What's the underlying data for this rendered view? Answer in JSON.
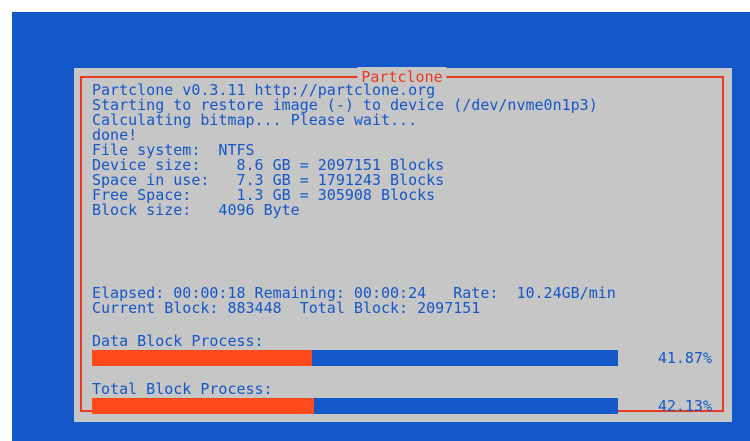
{
  "dialog": {
    "title": "Partclone"
  },
  "info": {
    "lines": [
      "Partclone v0.3.11 http://partclone.org",
      "Starting to restore image (-) to device (/dev/nvme0n1p3)",
      "Calculating bitmap... Please wait...",
      "done!",
      "File system:  NTFS",
      "Device size:    8.6 GB = 2097151 Blocks",
      "Space in use:   7.3 GB = 1791243 Blocks",
      "Free Space:     1.3 GB = 305908 Blocks",
      "Block size:   4096 Byte"
    ]
  },
  "stats": {
    "line1": "Elapsed: 00:00:18 Remaining: 00:00:24   Rate:  10.24GB/min",
    "line2": "Current Block: 883448  Total Block: 2097151"
  },
  "progress": {
    "data_block": {
      "label": "Data Block Process:",
      "percent_text": "41.87%",
      "fraction": 0.4187
    },
    "total_block": {
      "label": "Total Block Process:",
      "percent_text": "42.13%",
      "fraction": 0.4213
    }
  },
  "colors": {
    "background": "#1457c8",
    "dialog": "#c6c6c6",
    "accent": "#e83a1e",
    "progress_fill": "#ff4a1c"
  }
}
